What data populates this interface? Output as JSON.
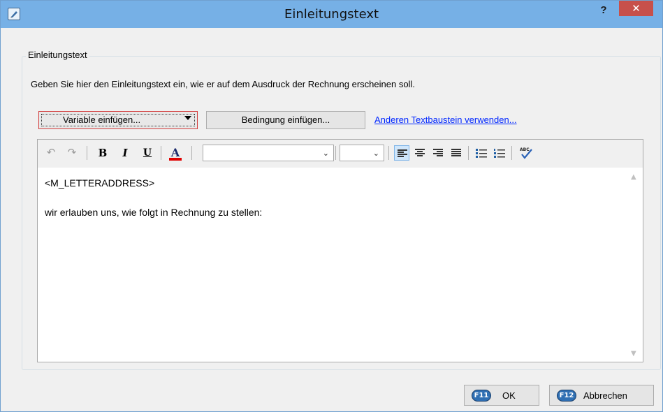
{
  "window": {
    "title": "Einleitungstext",
    "help_label": "?",
    "close_label": "✕"
  },
  "group": {
    "legend": "Einleitungstext",
    "instruction": "Geben Sie hier den Einleitungstext ein, wie er auf dem Ausdruck der Rechnung erscheinen soll."
  },
  "actions": {
    "variable_label": "Variable einfügen...",
    "condition_label": "Bedingung einfügen...",
    "other_block_link": "Anderen Textbaustein verwenden..."
  },
  "toolbar": {
    "undo_icon": "↶",
    "redo_icon": "↷",
    "bold_label": "B",
    "italic_label": "I",
    "underline_label": "U",
    "fontcolor_label": "A",
    "font_family_value": "",
    "font_size_value": "",
    "combo_arrow": "⌄",
    "spellcheck_label": "ABC"
  },
  "editor": {
    "lines": [
      "<M_LETTERADDRESS>",
      "wir erlauben uns, wie folgt in Rechnung zu stellen:"
    ],
    "scroll_up": "▲",
    "scroll_down": "▼"
  },
  "footer": {
    "ok_key": "F11",
    "ok_label": "OK",
    "cancel_key": "F12",
    "cancel_label": "Abbrechen"
  },
  "colors": {
    "titlebar": "#76b0e6",
    "close": "#c7504b",
    "link": "#0026ff",
    "fontcolor_bar": "#e00000",
    "fkey_badge": "#2f6fb3"
  }
}
